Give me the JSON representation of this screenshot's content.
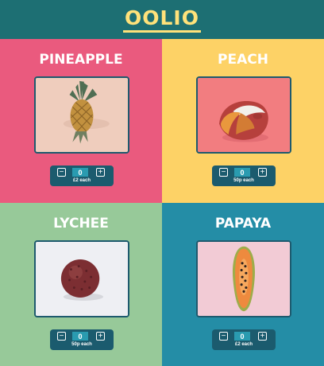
{
  "app": {
    "logo": "OOLIO"
  },
  "colors": {
    "header": "#1d6f73",
    "logo": "#ffe27a",
    "pineapple_tile": "#ea5a7e",
    "peach_tile": "#fdd266",
    "lychee_tile": "#97c999",
    "papaya_tile": "#248da6",
    "stepper": "#1b5b6e"
  },
  "products": [
    {
      "name": "PINEAPPLE",
      "quantity": "0",
      "price": "£2 each",
      "image_icon": "pineapple-photo"
    },
    {
      "name": "PEACH",
      "quantity": "0",
      "price": "50p each",
      "image_icon": "peach-photo"
    },
    {
      "name": "LYCHEE",
      "quantity": "0",
      "price": "50p each",
      "image_icon": "lychee-photo"
    },
    {
      "name": "PAPAYA",
      "quantity": "0",
      "price": "£2 each",
      "image_icon": "papaya-photo"
    }
  ],
  "stepper": {
    "minus_symbol": "−",
    "plus_symbol": "+"
  }
}
